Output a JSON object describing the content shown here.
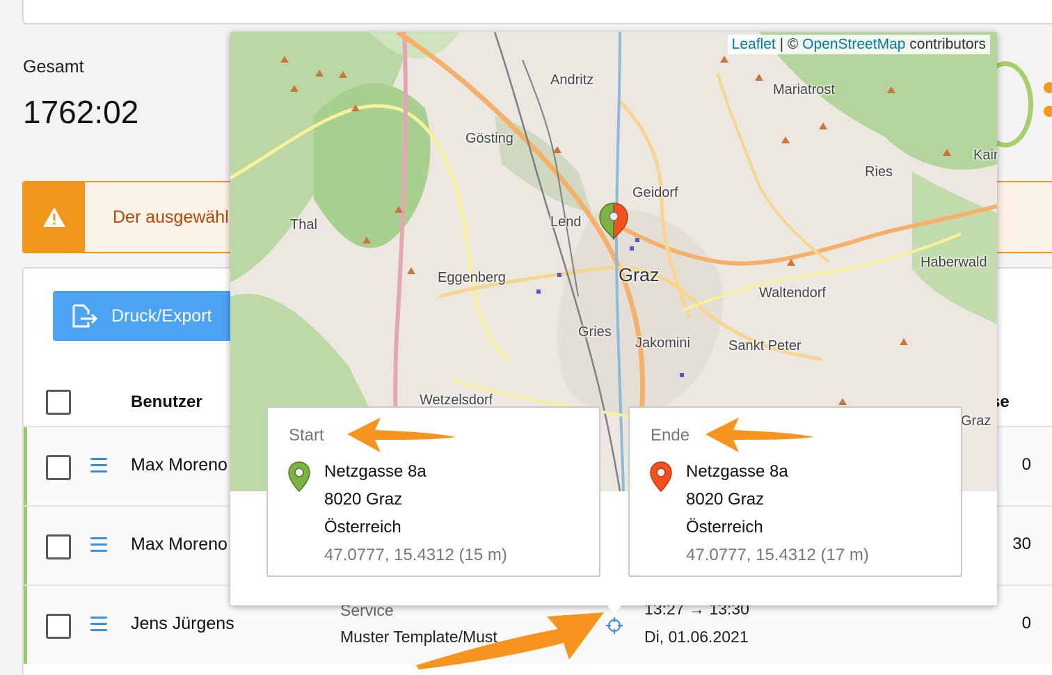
{
  "summary": {
    "total_label": "Gesamt",
    "total_value": "1762:02"
  },
  "alert": {
    "icon": "warning-icon",
    "text": "Der ausgewähl",
    "color": "#f2961b"
  },
  "toolbar": {
    "export_label": "Druck/Export",
    "export_icon": "export-icon"
  },
  "table": {
    "headers": {
      "user": "Benutzer",
      "right_partial": "se"
    },
    "rows": [
      {
        "name": "Max Moreno",
        "value": "0"
      },
      {
        "name": "Max Moreno",
        "value": "30"
      },
      {
        "name": "Jens Jürgens",
        "service": "Service",
        "template": "Muster Template/Must",
        "time": "13:27 → 13:30",
        "date": "Di, 01.06.2021",
        "value": "0"
      }
    ]
  },
  "map": {
    "attribution": {
      "leaflet": "Leaflet",
      "separator": " | © ",
      "osm": "OpenStreetMap",
      "suffix": " contributors"
    },
    "labels": {
      "andritz": "Andritz",
      "mariatrost": "Mariatrost",
      "gosting": "Gösting",
      "kain": "Kain",
      "ries": "Ries",
      "geidorf": "Geidorf",
      "thal": "Thal",
      "lend": "Lend",
      "graz": "Graz",
      "haberwald": "Haberwald",
      "eggenberg": "Eggenberg",
      "waltendorf": "Waltendorf",
      "gries": "Gries",
      "jakomini": "Jakomini",
      "sanktpeter": "Sankt Peter",
      "wetzelsdorf": "Wetzelsdorf",
      "graz_small": "Graz"
    }
  },
  "start": {
    "heading": "Start",
    "street": "Netzgasse 8a",
    "city": "8020 Graz",
    "country": "Österreich",
    "coords": "47.0777, 15.4312 (15 m)",
    "pin_color": "#7cb342"
  },
  "end": {
    "heading": "Ende",
    "street": "Netzgasse 8a",
    "city": "8020 Graz",
    "country": "Österreich",
    "coords": "47.0777, 15.4312 (17 m)",
    "pin_color": "#f4511e"
  },
  "colors": {
    "accent_blue": "#4ba3f2",
    "arrow": "#f7941d"
  }
}
